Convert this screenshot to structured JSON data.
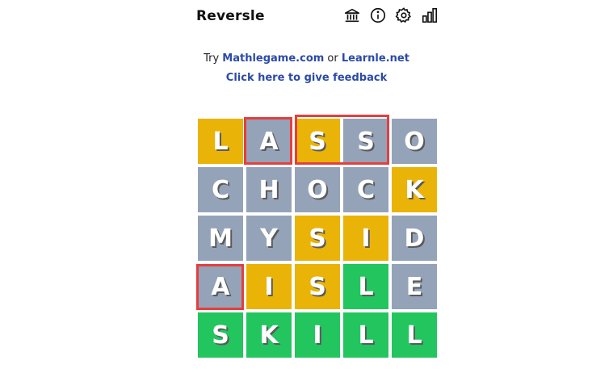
{
  "header": {
    "title": "Reversle"
  },
  "icons": [
    "bank-icon",
    "info-icon",
    "gear-icon",
    "stats-icon"
  ],
  "promo": {
    "prefix": "Try ",
    "link1": "Mathlegame.com",
    "middle": " or ",
    "link2": "Learnle.net"
  },
  "feedback": {
    "label": "Click here to give feedback"
  },
  "colors": {
    "gray": "#94a3b8",
    "yellow": "#eab308",
    "green": "#22c55e",
    "highlight": "#e53e3e",
    "link": "#2b4aa8"
  },
  "board": {
    "rows": [
      [
        {
          "letter": "L",
          "state": "yellow"
        },
        {
          "letter": "A",
          "state": "gray"
        },
        {
          "letter": "S",
          "state": "yellow"
        },
        {
          "letter": "S",
          "state": "gray"
        },
        {
          "letter": "O",
          "state": "gray"
        }
      ],
      [
        {
          "letter": "C",
          "state": "gray"
        },
        {
          "letter": "H",
          "state": "gray"
        },
        {
          "letter": "O",
          "state": "gray"
        },
        {
          "letter": "C",
          "state": "gray"
        },
        {
          "letter": "K",
          "state": "yellow"
        }
      ],
      [
        {
          "letter": "M",
          "state": "gray"
        },
        {
          "letter": "Y",
          "state": "gray"
        },
        {
          "letter": "S",
          "state": "yellow"
        },
        {
          "letter": "I",
          "state": "yellow"
        },
        {
          "letter": "D",
          "state": "gray"
        }
      ],
      [
        {
          "letter": "A",
          "state": "gray"
        },
        {
          "letter": "I",
          "state": "yellow"
        },
        {
          "letter": "S",
          "state": "yellow"
        },
        {
          "letter": "L",
          "state": "green"
        },
        {
          "letter": "E",
          "state": "gray"
        }
      ],
      [
        {
          "letter": "S",
          "state": "green"
        },
        {
          "letter": "K",
          "state": "green"
        },
        {
          "letter": "I",
          "state": "green"
        },
        {
          "letter": "L",
          "state": "green"
        },
        {
          "letter": "L",
          "state": "green"
        }
      ]
    ]
  }
}
